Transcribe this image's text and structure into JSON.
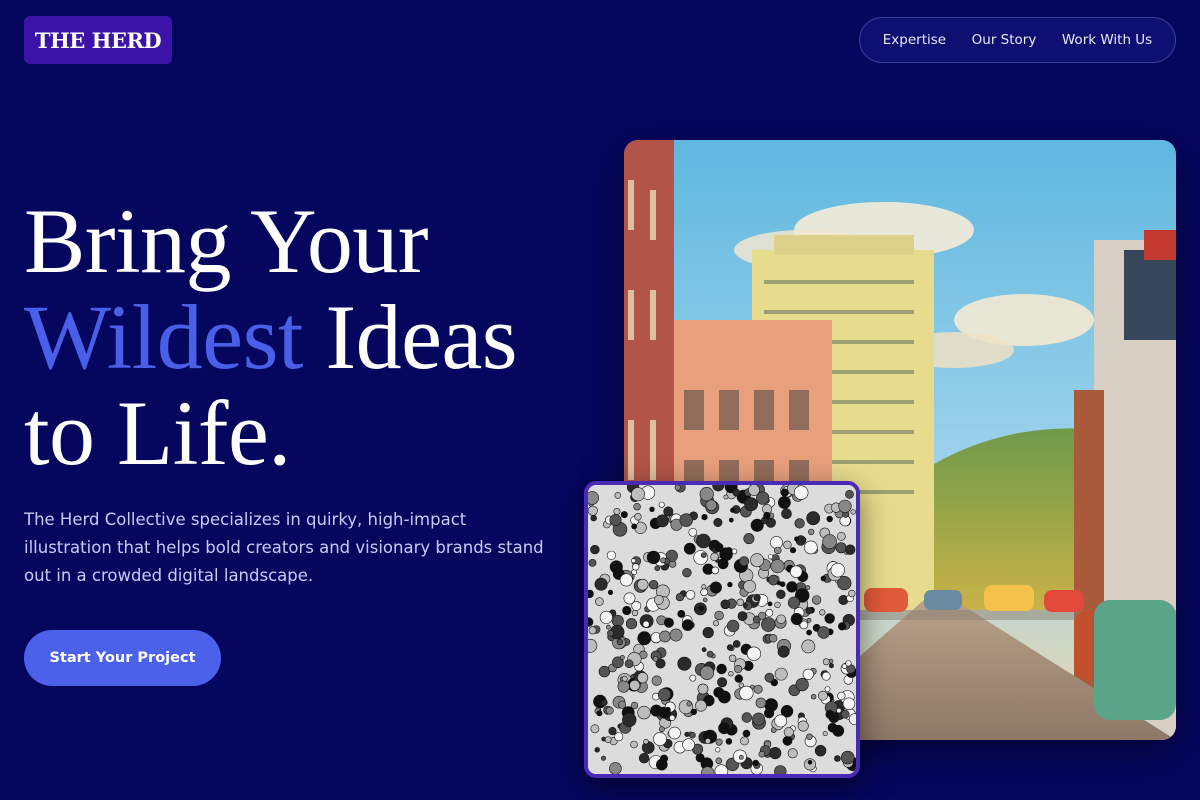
{
  "brand": {
    "logo_text": "THE HERD"
  },
  "nav": {
    "items": [
      {
        "label": "Expertise"
      },
      {
        "label": "Our Story"
      },
      {
        "label": "Work With Us"
      }
    ]
  },
  "hero": {
    "line1": "Bring Your",
    "accent_word": "Wildest",
    "line2_rest": " Ideas",
    "line3": "to Life.",
    "description": "The Herd Collective specializes in quirky, high-impact illustration that helps bold creators and visionary brands stand out in a crowded digital landscape.",
    "cta_label": "Start Your Project"
  },
  "colors": {
    "background": "#05065e",
    "accent": "#4a5fe8",
    "logo_bg": "#3c13a8",
    "button": "#4c61ea"
  }
}
